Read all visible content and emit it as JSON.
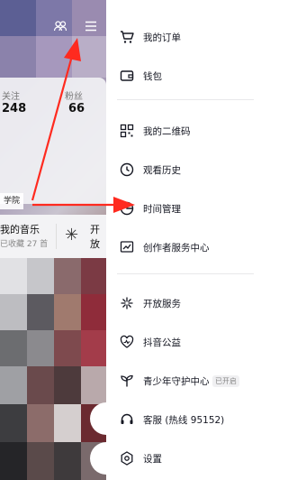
{
  "profile": {
    "following_label": "关注",
    "following_count": "248",
    "followers_label": "粉丝",
    "followers_count": "66",
    "school_tag": "学院",
    "music_title": "我的音乐",
    "music_sub": "已收藏 27 首",
    "open_label": "开放"
  },
  "drawer": {
    "items": [
      {
        "label": "我的订单",
        "icon": "cart-icon"
      },
      {
        "label": "钱包",
        "icon": "wallet-icon"
      },
      {
        "label": "我的二维码",
        "icon": "qrcode-icon"
      },
      {
        "label": "观看历史",
        "icon": "clock-icon"
      },
      {
        "label": "时间管理",
        "icon": "hourglass-icon"
      },
      {
        "label": "创作者服务中心",
        "icon": "chart-icon"
      },
      {
        "label": "开放服务",
        "icon": "star-icon"
      },
      {
        "label": "抖音公益",
        "icon": "heart-icon"
      },
      {
        "label": "青少年守护中心",
        "icon": "sprout-icon",
        "badge": "已开启"
      },
      {
        "label": "客服 (热线 95152)",
        "icon": "headset-icon"
      },
      {
        "label": "设置",
        "icon": "settings-icon"
      }
    ]
  },
  "colors": {
    "annotation_arrow": "#ff2a1f",
    "text": "#161823"
  }
}
